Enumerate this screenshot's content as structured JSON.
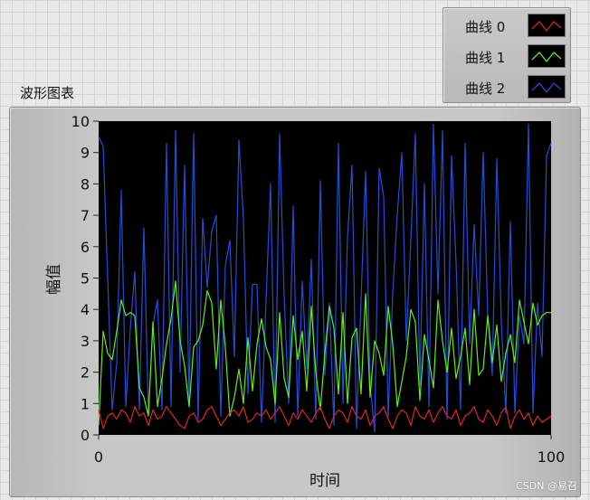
{
  "label": {
    "title": "波形图表"
  },
  "watermark": "CSDN @易召",
  "chart_data": {
    "type": "line",
    "xlabel": "时间",
    "ylabel": "幅值",
    "xlim": [
      0,
      100
    ],
    "ylim": [
      0,
      10
    ],
    "xticks": [
      "0",
      "100"
    ],
    "yticks": [
      "0",
      "1",
      "2",
      "3",
      "4",
      "5",
      "6",
      "7",
      "8",
      "9",
      "10"
    ],
    "grid": false,
    "background": "#000000",
    "legend_position": "top-right",
    "series": [
      {
        "name": "曲线 0",
        "color": "#e0212a",
        "values": [
          0.8,
          0.2,
          0.6,
          0.7,
          0.5,
          0.8,
          0.7,
          0.4,
          0.9,
          0.6,
          0.7,
          0.3,
          0.8,
          0.5,
          0.6,
          0.9,
          0.7,
          0.5,
          0.3,
          0.2,
          0.6,
          0.7,
          0.4,
          0.5,
          0.8,
          0.9,
          0.6,
          0.3,
          0.5,
          0.7,
          0.8,
          0.6,
          0.9,
          0.4,
          0.5,
          0.7,
          0.6,
          0.8,
          0.5,
          0.7,
          0.9,
          0.6,
          0.3,
          0.7,
          0.5,
          0.8,
          0.6,
          0.4,
          0.7,
          0.9,
          0.5,
          0.2,
          0.6,
          0.8,
          0.7,
          0.4,
          0.9,
          0.6,
          0.5,
          0.8,
          0.3,
          0.6,
          0.7,
          0.9,
          0.5,
          0.2,
          0.6,
          0.8,
          0.7,
          0.3,
          0.9,
          0.6,
          0.5,
          0.8,
          0.4,
          0.7,
          0.9,
          0.6,
          0.5,
          0.8,
          0.3,
          0.6,
          0.7,
          0.9,
          0.5,
          0.4,
          0.8,
          0.6,
          0.3,
          0.7,
          0.9,
          0.2,
          0.6,
          0.8,
          0.5,
          0.7,
          0.3,
          0.6,
          0.4,
          0.5,
          0.6
        ]
      },
      {
        "name": "曲线 1",
        "color": "#5ff00c",
        "values": [
          0.3,
          3.3,
          2.6,
          2.4,
          3.3,
          4.3,
          3.8,
          3.9,
          3.8,
          1.5,
          1.2,
          0.6,
          3.6,
          0.9,
          1.8,
          2.9,
          3.7,
          4.9,
          3.0,
          2.2,
          0.9,
          2.8,
          3.0,
          3.5,
          4.6,
          4.2,
          2.1,
          4.3,
          2.8,
          0.6,
          1.2,
          2.1,
          1.0,
          3.1,
          1.4,
          2.9,
          3.7,
          2.8,
          2.4,
          1.0,
          3.9,
          1.8,
          1.2,
          3.8,
          2.4,
          3.3,
          1.4,
          4.1,
          2.0,
          0.8,
          2.6,
          4.1,
          3.4,
          1.3,
          3.9,
          1.0,
          3.1,
          3.4,
          1.3,
          4.5,
          1.2,
          3.0,
          2.6,
          1.9,
          4.1,
          2.9,
          0.9,
          1.7,
          2.5,
          4.0,
          3.6,
          1.1,
          3.2,
          2.4,
          1.5,
          4.3,
          3.0,
          2.0,
          3.4,
          1.8,
          2.5,
          3.4,
          1.6,
          4.0,
          1.9,
          2.1,
          3.8,
          2.3,
          3.5,
          1.7,
          2.6,
          3.2,
          2.3,
          4.3,
          3.6,
          2.9,
          4.2,
          3.5,
          3.8,
          3.9,
          3.9
        ]
      },
      {
        "name": "曲线 2",
        "color": "#1f4fd8",
        "values": [
          9.5,
          9.2,
          5.0,
          0.8,
          2.3,
          7.8,
          0.9,
          3.4,
          5.2,
          0.8,
          6.6,
          0.7,
          3.5,
          4.3,
          0.8,
          9.3,
          0.9,
          9.7,
          2.0,
          8.6,
          1.1,
          9.6,
          0.5,
          6.9,
          4.7,
          6.5,
          7.0,
          0.6,
          5.4,
          6.2,
          2.5,
          9.4,
          6.9,
          1.3,
          4.8,
          4.8,
          0.4,
          4.3,
          8.0,
          0.4,
          9.6,
          4.4,
          1.0,
          7.3,
          0.6,
          4.9,
          2.1,
          5.6,
          0.5,
          8.1,
          1.9,
          4.2,
          0.3,
          9.3,
          1.0,
          6.3,
          8.6,
          0.2,
          4.3,
          8.4,
          1.6,
          0.1,
          8.5,
          7.6,
          0.6,
          4.5,
          7.0,
          9.0,
          3.0,
          6.2,
          9.6,
          1.6,
          8.0,
          0.9,
          9.9,
          4.5,
          9.7,
          0.5,
          8.9,
          5.5,
          0.8,
          9.3,
          2.9,
          6.7,
          3.8,
          9.0,
          3.8,
          1.9,
          8.8,
          3.6,
          0.7,
          6.8,
          0.7,
          3.8,
          2.9,
          9.9,
          0.7,
          4.2,
          2.5,
          8.9,
          9.3
        ]
      }
    ]
  }
}
